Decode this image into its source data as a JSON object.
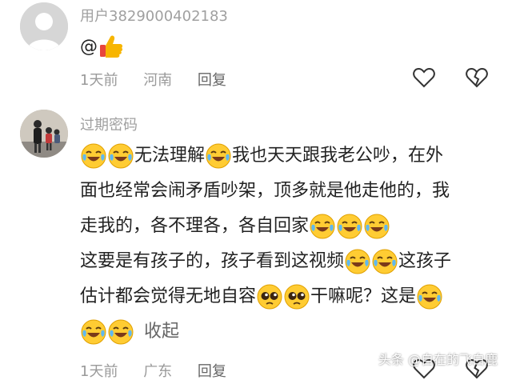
{
  "comment1": {
    "username": "用户3829000402183",
    "body_prefix": "@",
    "emoji": "thumbs-up",
    "time": "1天前",
    "location": "河南",
    "reply": "回复"
  },
  "comment2": {
    "username": "过期密码",
    "lines": [
      [
        "无法理解",
        "我也天天跟我老公吵，在外"
      ],
      [
        "面也经常会闹矛盾吵架，顶多就是他走他的，我"
      ],
      [
        "走我的，各不理各，各自回家"
      ],
      [
        "这要是有孩子的，孩子看到这视频",
        "这孩子"
      ],
      [
        "估计都会觉得无地自容",
        "干嘛呢？这是"
      ]
    ],
    "collapse": "收起",
    "time": "1天前",
    "location": "广东",
    "reply": "回复"
  },
  "watermark": "头条 @自在的飞白鹿",
  "colors": {
    "meta": "#9a9a9a",
    "username": "#a0a0a0",
    "emoji_face": "#ffcc33"
  }
}
